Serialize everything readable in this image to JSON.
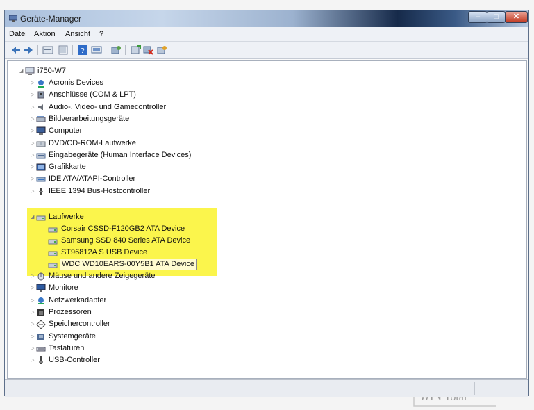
{
  "window": {
    "title": "Geräte-Manager"
  },
  "menu": [
    "Datei",
    "Aktion",
    "Ansicht",
    "?"
  ],
  "toolbar": [
    "back-icon",
    "forward-icon",
    "properties-icon",
    "show-hide-icon",
    "help-icon",
    "computer-view-icon",
    "scan-hardware-icon",
    "update-driver-icon",
    "disable-device-icon",
    "uninstall-device-icon"
  ],
  "tree": {
    "root": "i750-W7",
    "categories_top": [
      {
        "label": "Acronis Devices",
        "icon": "acronis"
      },
      {
        "label": "Anschlüsse (COM & LPT)",
        "icon": "port"
      },
      {
        "label": "Audio-, Video- und Gamecontroller",
        "icon": "audio"
      },
      {
        "label": "Bildverarbeitungsgeräte",
        "icon": "scanner"
      },
      {
        "label": "Computer",
        "icon": "computer"
      },
      {
        "label": "DVD/CD-ROM-Laufwerke",
        "icon": "dvd"
      },
      {
        "label": "Eingabegeräte (Human Interface Devices)",
        "icon": "hid"
      },
      {
        "label": "Grafikkarte",
        "icon": "display"
      },
      {
        "label": "IDE ATA/ATAPI-Controller",
        "icon": "ide"
      },
      {
        "label": "IEEE 1394 Bus-Hostcontroller",
        "icon": "firewire"
      }
    ],
    "expanded": {
      "label": "Laufwerke",
      "icon": "drive",
      "children": [
        "Corsair CSSD-F120GB2 ATA Device",
        "Samsung SSD 840 Series ATA Device",
        "ST96812A S USB Device",
        "WDC WD10EARS-00Y5B1 ATA Device"
      ]
    },
    "categories_bottom": [
      {
        "label": "Mäuse und andere Zeigegeräte",
        "icon": "mouse"
      },
      {
        "label": "Monitore",
        "icon": "monitor"
      },
      {
        "label": "Netzwerkadapter",
        "icon": "network"
      },
      {
        "label": "Prozessoren",
        "icon": "cpu"
      },
      {
        "label": "Speichercontroller",
        "icon": "storage"
      },
      {
        "label": "Systemgeräte",
        "icon": "system"
      },
      {
        "label": "Tastaturen",
        "icon": "keyboard"
      },
      {
        "label": "USB-Controller",
        "icon": "usb"
      }
    ]
  },
  "watermark": "WIN Total",
  "colors": {
    "highlight": "#fbf54c",
    "title_dark": "#162a4a"
  }
}
